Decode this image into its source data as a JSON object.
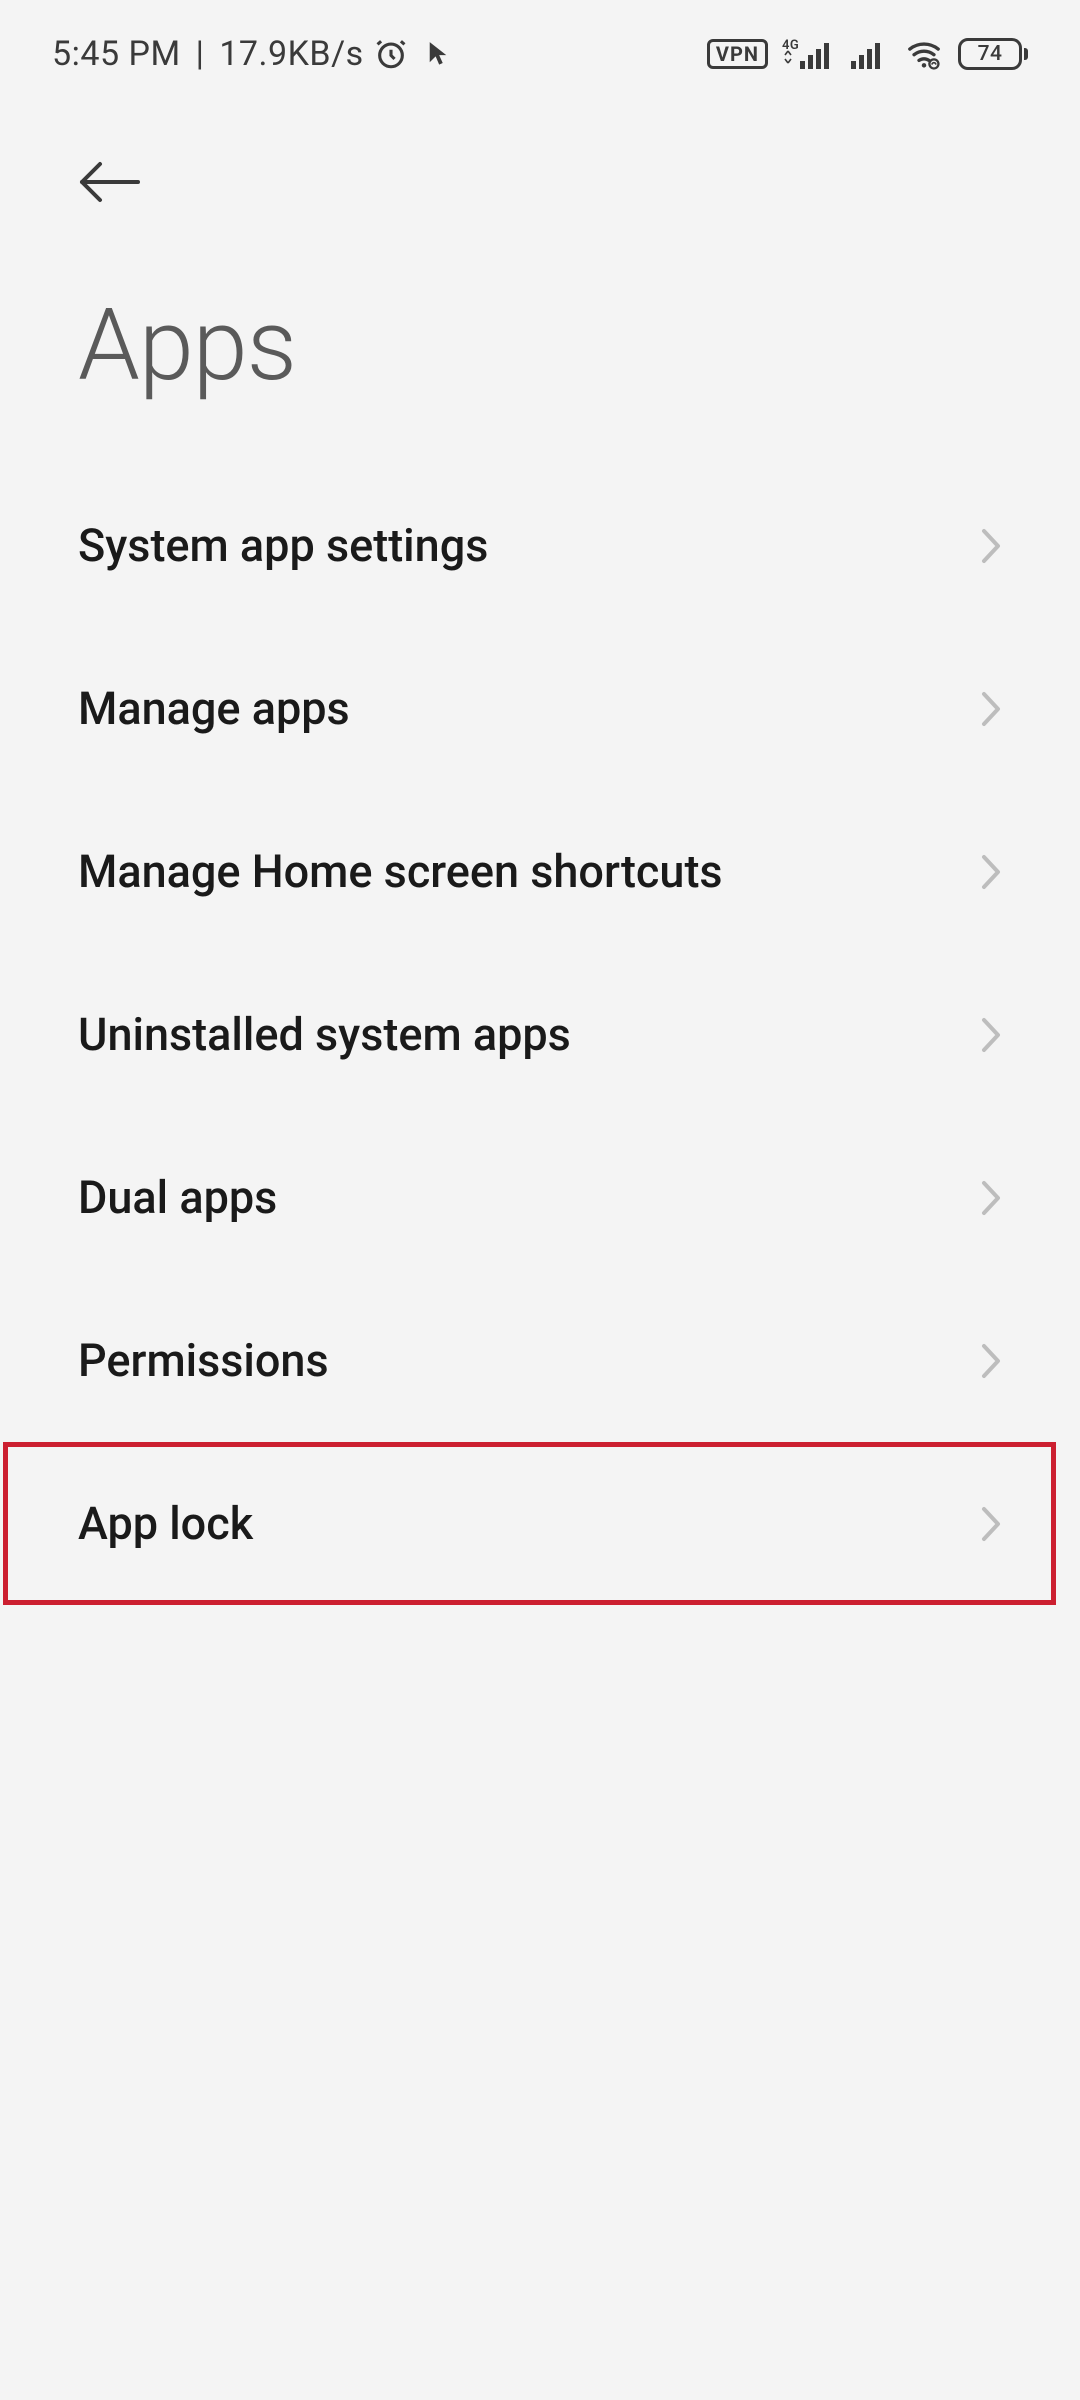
{
  "statusbar": {
    "time": "5:45 PM",
    "net_speed": "17.9KB/s",
    "vpn": "VPN",
    "network_label": "4G",
    "battery": "74"
  },
  "page": {
    "title": "Apps"
  },
  "items": [
    {
      "label": "System app settings",
      "highlight": false
    },
    {
      "label": "Manage apps",
      "highlight": false
    },
    {
      "label": "Manage Home screen shortcuts",
      "highlight": false
    },
    {
      "label": "Uninstalled system apps",
      "highlight": false
    },
    {
      "label": "Dual apps",
      "highlight": false
    },
    {
      "label": "Permissions",
      "highlight": false
    },
    {
      "label": "App lock",
      "highlight": true
    }
  ]
}
